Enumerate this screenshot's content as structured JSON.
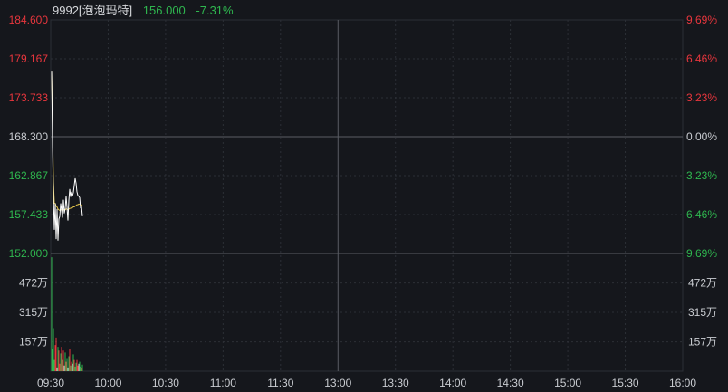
{
  "quote": {
    "code_name": "9992[泡泡玛特]",
    "price": "156.000",
    "change_pct": "-7.31%"
  },
  "colors": {
    "background": "#15171c",
    "grid": "#2c2f36",
    "up": "#e8363d",
    "down": "#2fb74f",
    "neutral": "#c9ccd1",
    "price_line": "#ffffff",
    "avg_line": "#e3c44a"
  },
  "price_axis": {
    "left_labels": [
      "184.600",
      "179.167",
      "173.733",
      "168.300",
      "162.867",
      "157.433",
      "152.000"
    ],
    "right_labels": [
      "9.69%",
      "6.46%",
      "3.23%",
      "0.00%",
      "3.23%",
      "6.46%",
      "9.69%"
    ],
    "label_colors": [
      "up",
      "up",
      "up",
      "neutral",
      "down",
      "down",
      "down"
    ],
    "min": 152.0,
    "max": 184.6
  },
  "volume_axis": {
    "labels": [
      "472万",
      "315万",
      "157万"
    ],
    "max": 630
  },
  "time_axis": {
    "labels": [
      "09:30",
      "10:00",
      "10:30",
      "11:00",
      "11:30",
      "13:00",
      "13:30",
      "14:00",
      "14:30",
      "15:00",
      "15:30",
      "16:00"
    ]
  },
  "chart_data": {
    "type": "line",
    "price_series": [
      177.5,
      167.0,
      160.0,
      155.3,
      159.0,
      154.0,
      158.2,
      153.8,
      156.8,
      157.2,
      159.0,
      158.0,
      157.0,
      159.5,
      157.6,
      158.3,
      160.0,
      158.4,
      156.6,
      159.4,
      161.0,
      159.9,
      160.6,
      160.0,
      160.5,
      161.5,
      162.5,
      161.8,
      160.6,
      160.1,
      160.0,
      159.8,
      158.3,
      158.6,
      157.2
    ],
    "avg_series": [
      177.5,
      170.0,
      162.0,
      159.0,
      159.0,
      158.6,
      158.5,
      158.2,
      158.1,
      158.0,
      158.1,
      158.1,
      158.0,
      158.1,
      158.1,
      158.1,
      158.2,
      158.2,
      158.1,
      158.2,
      158.3,
      158.3,
      158.4,
      158.4,
      158.5,
      158.5,
      158.6,
      158.7,
      158.8,
      158.8,
      158.9,
      158.9,
      158.8,
      158.8,
      158.6
    ],
    "volume_series": [
      610,
      120,
      230,
      60,
      140,
      180,
      20,
      130,
      110,
      40,
      95,
      130,
      60,
      110,
      30,
      100,
      50,
      70,
      20,
      80,
      120,
      30,
      50,
      40,
      90,
      60,
      25,
      45,
      60,
      30,
      40,
      50,
      25,
      20,
      35
    ],
    "volume_colors": [
      "down",
      "down",
      "down",
      "down",
      "up",
      "up",
      "neutral",
      "down",
      "up",
      "up",
      "down",
      "up",
      "down",
      "up",
      "neutral",
      "down",
      "up",
      "down",
      "neutral",
      "down",
      "up",
      "down",
      "up",
      "neutral",
      "down",
      "up",
      "down",
      "down",
      "up",
      "up",
      "neutral",
      "down",
      "down",
      "up",
      "down"
    ]
  }
}
